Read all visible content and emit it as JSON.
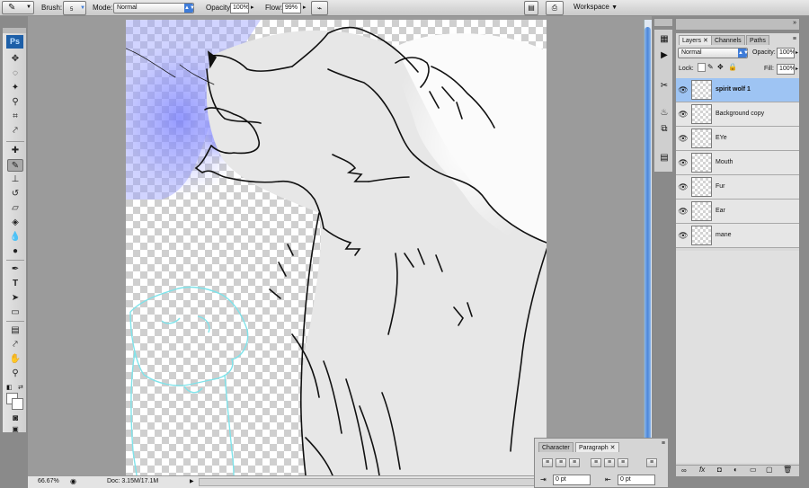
{
  "options_bar": {
    "brush_label": "Brush:",
    "brush_size": "5",
    "mode_label": "Mode:",
    "mode_value": "Normal",
    "opacity_label": "Opacity:",
    "opacity_value": "100%",
    "flow_label": "Flow:",
    "flow_value": "99%",
    "workspace_label": "Workspace"
  },
  "toolbox": {
    "logo": "Ps"
  },
  "status_bar": {
    "zoom": "66.67%",
    "doc_info": "Doc: 3.15M/17.1M"
  },
  "layers_panel": {
    "tabs": [
      "Layers",
      "Channels",
      "Paths"
    ],
    "blend_mode": "Normal",
    "opacity_label": "Opacity:",
    "opacity_value": "100%",
    "lock_label": "Lock:",
    "fill_label": "Fill:",
    "fill_value": "100%",
    "layers": [
      {
        "name": "spirit wolf 1",
        "selected": true
      },
      {
        "name": "Background copy",
        "selected": false
      },
      {
        "name": "EYe",
        "selected": false
      },
      {
        "name": "Mouth",
        "selected": false
      },
      {
        "name": "Fur",
        "selected": false
      },
      {
        "name": "Ear",
        "selected": false
      },
      {
        "name": "mane",
        "selected": false
      }
    ]
  },
  "char_panel": {
    "tabs": [
      "Character",
      "Paragraph"
    ],
    "indent_left": "0 pt",
    "indent_right": "0 pt"
  },
  "colors": {
    "selection": "#9ec4f3",
    "accent": "#3f7cd8",
    "glow": "#6b72ff",
    "outline_cyan": "#7fe3ea"
  }
}
